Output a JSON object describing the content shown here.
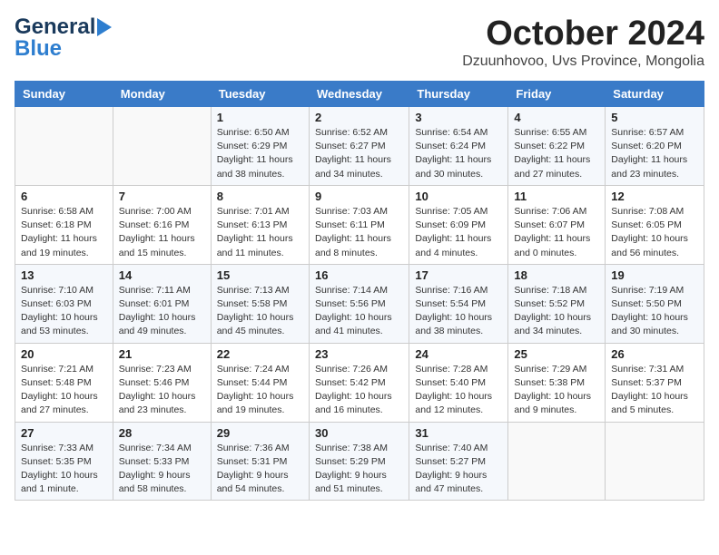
{
  "header": {
    "logo_line1": "General",
    "logo_line2": "Blue",
    "title": "October 2024",
    "subtitle": "Dzuunhovoo, Uvs Province, Mongolia"
  },
  "weekdays": [
    "Sunday",
    "Monday",
    "Tuesday",
    "Wednesday",
    "Thursday",
    "Friday",
    "Saturday"
  ],
  "weeks": [
    [
      {
        "day": "",
        "info": ""
      },
      {
        "day": "",
        "info": ""
      },
      {
        "day": "1",
        "info": "Sunrise: 6:50 AM\nSunset: 6:29 PM\nDaylight: 11 hours and 38 minutes."
      },
      {
        "day": "2",
        "info": "Sunrise: 6:52 AM\nSunset: 6:27 PM\nDaylight: 11 hours and 34 minutes."
      },
      {
        "day": "3",
        "info": "Sunrise: 6:54 AM\nSunset: 6:24 PM\nDaylight: 11 hours and 30 minutes."
      },
      {
        "day": "4",
        "info": "Sunrise: 6:55 AM\nSunset: 6:22 PM\nDaylight: 11 hours and 27 minutes."
      },
      {
        "day": "5",
        "info": "Sunrise: 6:57 AM\nSunset: 6:20 PM\nDaylight: 11 hours and 23 minutes."
      }
    ],
    [
      {
        "day": "6",
        "info": "Sunrise: 6:58 AM\nSunset: 6:18 PM\nDaylight: 11 hours and 19 minutes."
      },
      {
        "day": "7",
        "info": "Sunrise: 7:00 AM\nSunset: 6:16 PM\nDaylight: 11 hours and 15 minutes."
      },
      {
        "day": "8",
        "info": "Sunrise: 7:01 AM\nSunset: 6:13 PM\nDaylight: 11 hours and 11 minutes."
      },
      {
        "day": "9",
        "info": "Sunrise: 7:03 AM\nSunset: 6:11 PM\nDaylight: 11 hours and 8 minutes."
      },
      {
        "day": "10",
        "info": "Sunrise: 7:05 AM\nSunset: 6:09 PM\nDaylight: 11 hours and 4 minutes."
      },
      {
        "day": "11",
        "info": "Sunrise: 7:06 AM\nSunset: 6:07 PM\nDaylight: 11 hours and 0 minutes."
      },
      {
        "day": "12",
        "info": "Sunrise: 7:08 AM\nSunset: 6:05 PM\nDaylight: 10 hours and 56 minutes."
      }
    ],
    [
      {
        "day": "13",
        "info": "Sunrise: 7:10 AM\nSunset: 6:03 PM\nDaylight: 10 hours and 53 minutes."
      },
      {
        "day": "14",
        "info": "Sunrise: 7:11 AM\nSunset: 6:01 PM\nDaylight: 10 hours and 49 minutes."
      },
      {
        "day": "15",
        "info": "Sunrise: 7:13 AM\nSunset: 5:58 PM\nDaylight: 10 hours and 45 minutes."
      },
      {
        "day": "16",
        "info": "Sunrise: 7:14 AM\nSunset: 5:56 PM\nDaylight: 10 hours and 41 minutes."
      },
      {
        "day": "17",
        "info": "Sunrise: 7:16 AM\nSunset: 5:54 PM\nDaylight: 10 hours and 38 minutes."
      },
      {
        "day": "18",
        "info": "Sunrise: 7:18 AM\nSunset: 5:52 PM\nDaylight: 10 hours and 34 minutes."
      },
      {
        "day": "19",
        "info": "Sunrise: 7:19 AM\nSunset: 5:50 PM\nDaylight: 10 hours and 30 minutes."
      }
    ],
    [
      {
        "day": "20",
        "info": "Sunrise: 7:21 AM\nSunset: 5:48 PM\nDaylight: 10 hours and 27 minutes."
      },
      {
        "day": "21",
        "info": "Sunrise: 7:23 AM\nSunset: 5:46 PM\nDaylight: 10 hours and 23 minutes."
      },
      {
        "day": "22",
        "info": "Sunrise: 7:24 AM\nSunset: 5:44 PM\nDaylight: 10 hours and 19 minutes."
      },
      {
        "day": "23",
        "info": "Sunrise: 7:26 AM\nSunset: 5:42 PM\nDaylight: 10 hours and 16 minutes."
      },
      {
        "day": "24",
        "info": "Sunrise: 7:28 AM\nSunset: 5:40 PM\nDaylight: 10 hours and 12 minutes."
      },
      {
        "day": "25",
        "info": "Sunrise: 7:29 AM\nSunset: 5:38 PM\nDaylight: 10 hours and 9 minutes."
      },
      {
        "day": "26",
        "info": "Sunrise: 7:31 AM\nSunset: 5:37 PM\nDaylight: 10 hours and 5 minutes."
      }
    ],
    [
      {
        "day": "27",
        "info": "Sunrise: 7:33 AM\nSunset: 5:35 PM\nDaylight: 10 hours and 1 minute."
      },
      {
        "day": "28",
        "info": "Sunrise: 7:34 AM\nSunset: 5:33 PM\nDaylight: 9 hours and 58 minutes."
      },
      {
        "day": "29",
        "info": "Sunrise: 7:36 AM\nSunset: 5:31 PM\nDaylight: 9 hours and 54 minutes."
      },
      {
        "day": "30",
        "info": "Sunrise: 7:38 AM\nSunset: 5:29 PM\nDaylight: 9 hours and 51 minutes."
      },
      {
        "day": "31",
        "info": "Sunrise: 7:40 AM\nSunset: 5:27 PM\nDaylight: 9 hours and 47 minutes."
      },
      {
        "day": "",
        "info": ""
      },
      {
        "day": "",
        "info": ""
      }
    ]
  ]
}
